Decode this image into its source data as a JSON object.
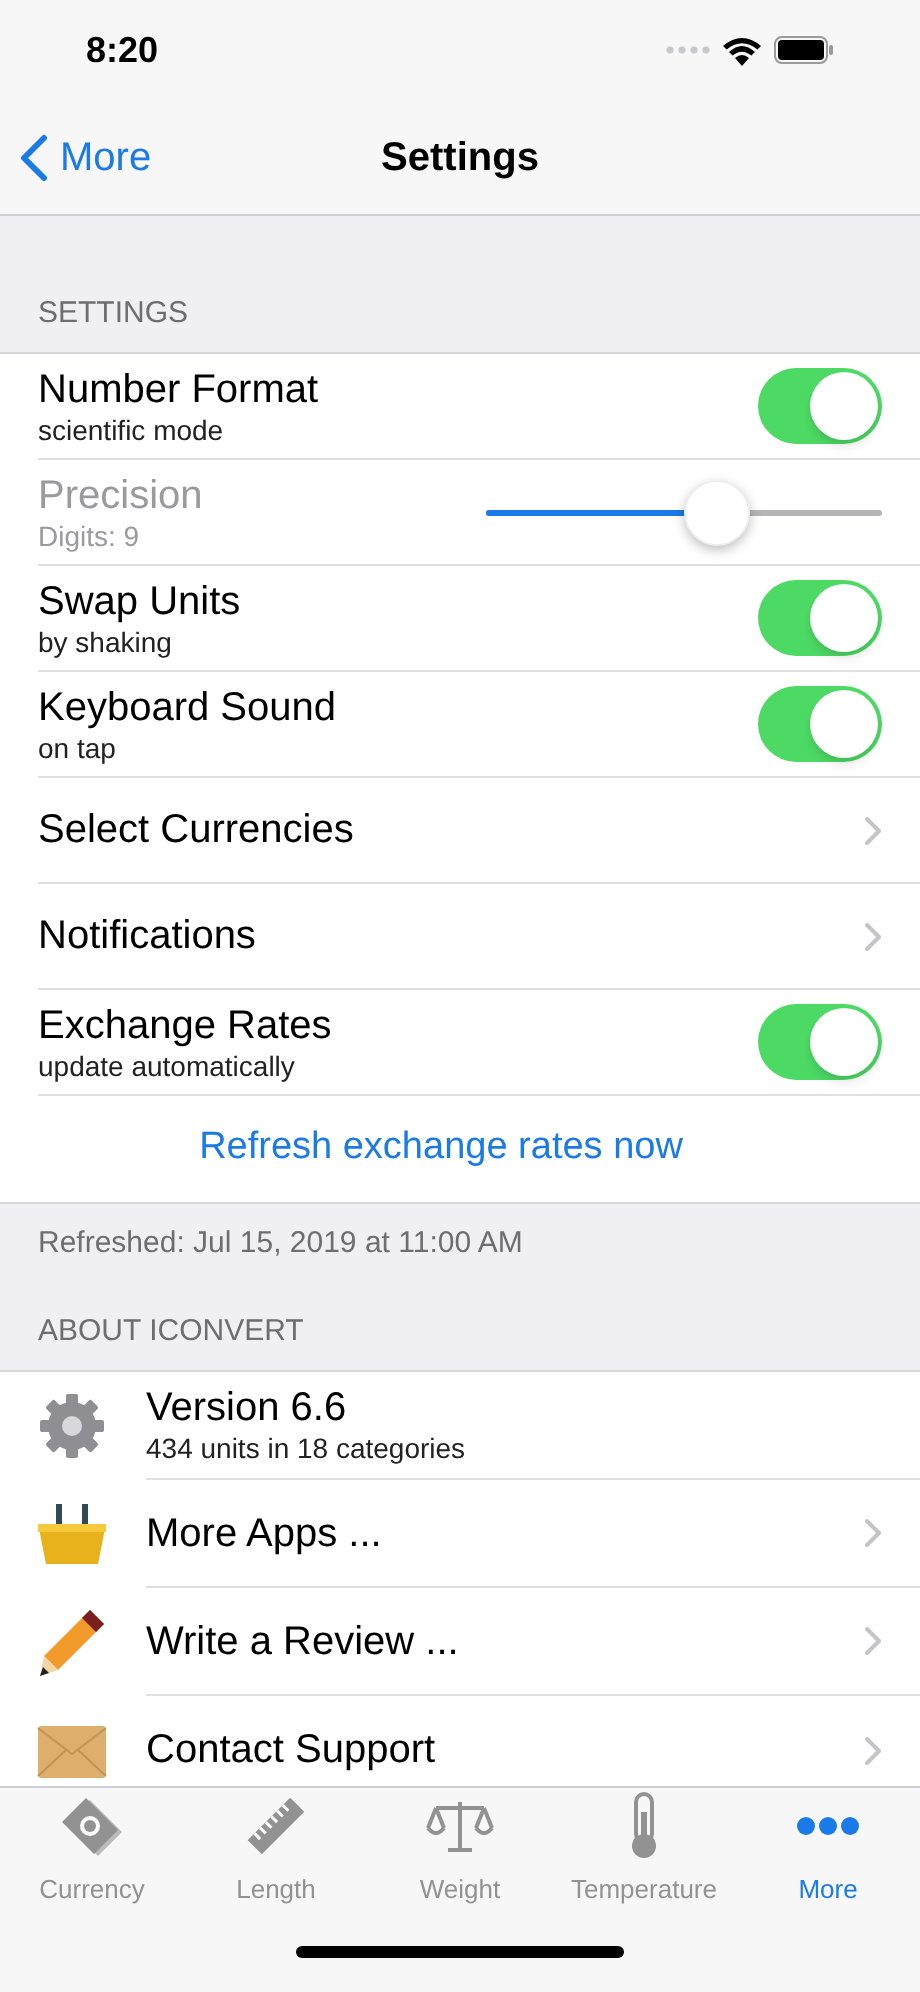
{
  "status_bar": {
    "time": "8:20"
  },
  "nav": {
    "back": "More",
    "title": "Settings"
  },
  "settings_section": {
    "header": "SETTINGS",
    "rows": [
      {
        "kind": "toggle",
        "title": "Number Format",
        "subtitle": "scientific mode",
        "on": true,
        "disabled": false
      },
      {
        "kind": "slider",
        "title": "Precision",
        "subtitle": "Digits: 9",
        "level": 0.58,
        "disabled": true
      },
      {
        "kind": "toggle",
        "title": "Swap Units",
        "subtitle": "by shaking",
        "on": true,
        "disabled": false
      },
      {
        "kind": "toggle",
        "title": "Keyboard Sound",
        "subtitle": "on tap",
        "on": true,
        "disabled": false
      },
      {
        "kind": "link",
        "title": "Select Currencies",
        "disabled": false
      },
      {
        "kind": "link",
        "title": "Notifications",
        "disabled": false
      },
      {
        "kind": "toggle",
        "title": "Exchange Rates",
        "subtitle": "update automatically",
        "on": true,
        "disabled": false
      },
      {
        "kind": "action",
        "title": "Refresh exchange rates now",
        "disabled": false
      }
    ],
    "footer": "Refreshed: Jul 15, 2019 at 11:00 AM"
  },
  "about_section": {
    "header": "ABOUT ICONVERT",
    "rows": [
      {
        "kind": "info",
        "title": "Version 6.6",
        "subtitle": "434 units in 18 categories"
      },
      {
        "kind": "link",
        "title": "More Apps ..."
      },
      {
        "kind": "link",
        "title": "Write a Review ..."
      },
      {
        "kind": "link",
        "title": "Contact Support"
      }
    ]
  },
  "tab_bar": {
    "items": [
      {
        "label": "Currency",
        "selected": false
      },
      {
        "label": "Length",
        "selected": false
      },
      {
        "label": "Weight",
        "selected": false
      },
      {
        "label": "Temperature",
        "selected": false
      },
      {
        "label": "More",
        "selected": true
      }
    ]
  }
}
